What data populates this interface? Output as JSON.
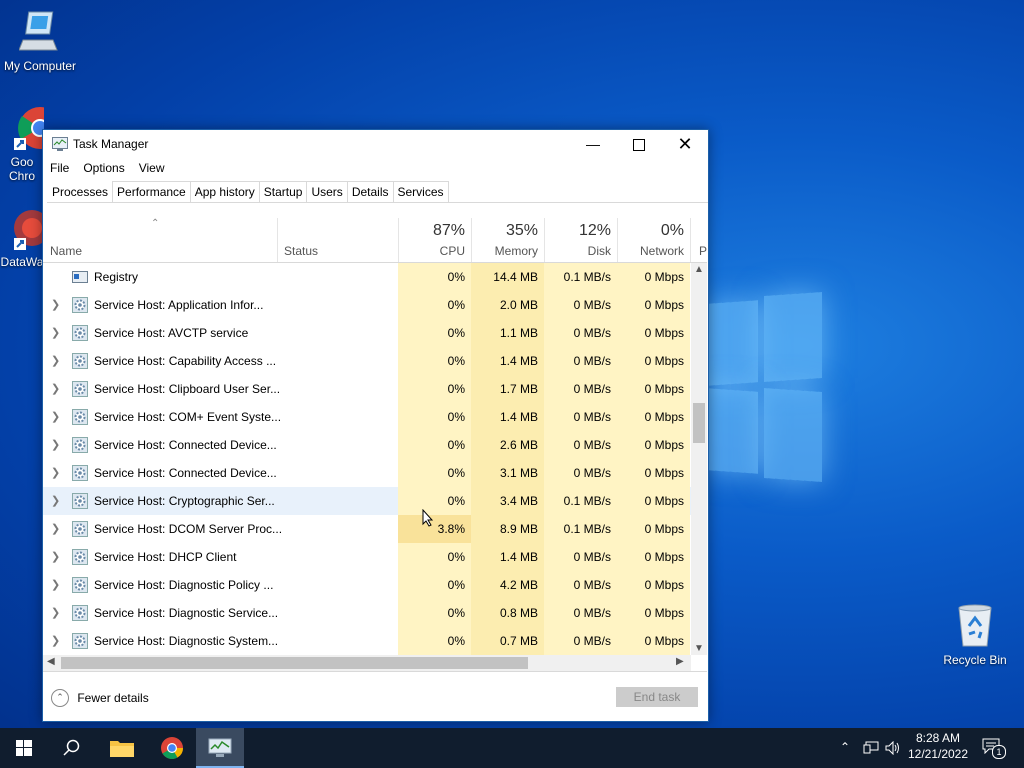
{
  "desktop": {
    "icons": [
      {
        "label": "My Computer"
      },
      {
        "label": "Goo\nChro"
      },
      {
        "label": "DataWa"
      },
      {
        "label": "Recycle Bin"
      }
    ]
  },
  "window": {
    "title": "Task Manager",
    "menu": [
      "File",
      "Options",
      "View"
    ],
    "tabs": [
      "Processes",
      "Performance",
      "App history",
      "Startup",
      "Users",
      "Details",
      "Services"
    ],
    "active_tab": "Processes",
    "columns": {
      "name": "Name",
      "status": "Status",
      "cpu": {
        "pct": "87%",
        "label": "CPU"
      },
      "memory": {
        "pct": "35%",
        "label": "Memory"
      },
      "disk": {
        "pct": "12%",
        "label": "Disk"
      },
      "network": {
        "pct": "0%",
        "label": "Network"
      },
      "power": "P"
    },
    "rows": [
      {
        "name": "Registry",
        "cpu": "0%",
        "memory": "14.4 MB",
        "disk": "0.1 MB/s",
        "network": "0 Mbps",
        "expandable": false
      },
      {
        "name": "Service Host: Application Infor...",
        "cpu": "0%",
        "memory": "2.0 MB",
        "disk": "0 MB/s",
        "network": "0 Mbps",
        "expandable": true
      },
      {
        "name": "Service Host: AVCTP service",
        "cpu": "0%",
        "memory": "1.1 MB",
        "disk": "0 MB/s",
        "network": "0 Mbps",
        "expandable": true
      },
      {
        "name": "Service Host: Capability Access ...",
        "cpu": "0%",
        "memory": "1.4 MB",
        "disk": "0 MB/s",
        "network": "0 Mbps",
        "expandable": true
      },
      {
        "name": "Service Host: Clipboard User Ser...",
        "cpu": "0%",
        "memory": "1.7 MB",
        "disk": "0 MB/s",
        "network": "0 Mbps",
        "expandable": true
      },
      {
        "name": "Service Host: COM+ Event Syste...",
        "cpu": "0%",
        "memory": "1.4 MB",
        "disk": "0 MB/s",
        "network": "0 Mbps",
        "expandable": true
      },
      {
        "name": "Service Host: Connected Device...",
        "cpu": "0%",
        "memory": "2.6 MB",
        "disk": "0 MB/s",
        "network": "0 Mbps",
        "expandable": true
      },
      {
        "name": "Service Host: Connected Device...",
        "cpu": "0%",
        "memory": "3.1 MB",
        "disk": "0 MB/s",
        "network": "0 Mbps",
        "expandable": true
      },
      {
        "name": "Service Host: Cryptographic Ser...",
        "cpu": "0%",
        "memory": "3.4 MB",
        "disk": "0.1 MB/s",
        "network": "0 Mbps",
        "expandable": true
      },
      {
        "name": "Service Host: DCOM Server Proc...",
        "cpu": "3.8%",
        "memory": "8.9 MB",
        "disk": "0.1 MB/s",
        "network": "0 Mbps",
        "expandable": true
      },
      {
        "name": "Service Host: DHCP Client",
        "cpu": "0%",
        "memory": "1.4 MB",
        "disk": "0 MB/s",
        "network": "0 Mbps",
        "expandable": true
      },
      {
        "name": "Service Host: Diagnostic Policy ...",
        "cpu": "0%",
        "memory": "4.2 MB",
        "disk": "0 MB/s",
        "network": "0 Mbps",
        "expandable": true
      },
      {
        "name": "Service Host: Diagnostic Service...",
        "cpu": "0%",
        "memory": "0.8 MB",
        "disk": "0 MB/s",
        "network": "0 Mbps",
        "expandable": true
      },
      {
        "name": "Service Host: Diagnostic System...",
        "cpu": "0%",
        "memory": "0.7 MB",
        "disk": "0 MB/s",
        "network": "0 Mbps",
        "expandable": true
      }
    ],
    "footer": {
      "fewer_details": "Fewer details",
      "end_task": "End task"
    }
  },
  "taskbar": {
    "time": "8:28 AM",
    "date": "12/21/2022",
    "notification_count": "1"
  },
  "colors": {
    "accent": "#0078d7",
    "cpu_heat": "#fff4c4",
    "memory_heat": "#fcedb0"
  }
}
